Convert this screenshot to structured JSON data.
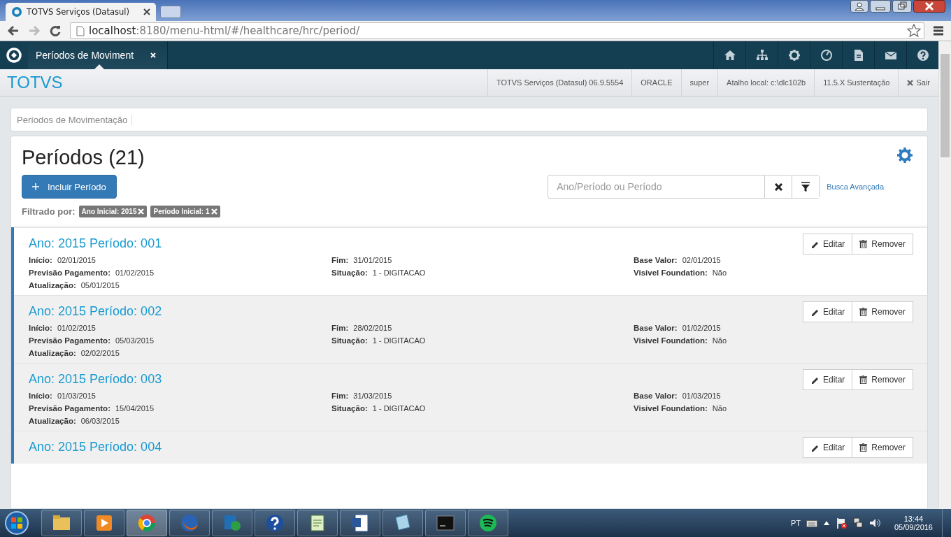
{
  "browser": {
    "tab_title": "TOTVS Serviços (Datasul)",
    "url_host": "localhost",
    "url_path": ":8180/menu-html/#/healthcare/hrc/period/"
  },
  "app_tabs": [
    {
      "label": "Períodos de Moviment",
      "selected": true
    }
  ],
  "header": {
    "brand": "TOTVS",
    "info": [
      "TOTVS Serviços (Datasul) 06.9.5554",
      "ORACLE",
      "super",
      "Atalho local: c:\\dlc102b",
      "11.5.X Sustentação"
    ],
    "logout": "Sair"
  },
  "breadcrumb": [
    "Períodos de Movimentação"
  ],
  "page": {
    "title": "Períodos (21)",
    "add_button": "Incluir Período",
    "search": {
      "placeholder": "Ano/Período ou Período"
    },
    "advanced_link": "Busca Avançada",
    "filter_label": "Filtrado por:",
    "filters": [
      "Ano Inicial: 2015",
      "Período Inicial: 1"
    ]
  },
  "periods": [
    {
      "title": "Ano: 2015 Período: 001",
      "edit": "Editar",
      "remove": "Remover",
      "fields": [
        {
          "label": "Início:",
          "value": "02/01/2015"
        },
        {
          "label": "Fim:",
          "value": "31/01/2015"
        },
        {
          "label": "Base Valor:",
          "value": "02/01/2015"
        },
        {
          "label": "Previsão Pagamento:",
          "value": "01/02/2015"
        },
        {
          "label": "Situação:",
          "value": "1 - DIGITACAO"
        },
        {
          "label": "Visivel Foundation:",
          "value": "Não"
        },
        {
          "label": "Atualização:",
          "value": "05/01/2015"
        }
      ]
    },
    {
      "title": "Ano: 2015 Período: 002",
      "edit": "Editar",
      "remove": "Remover",
      "fields": [
        {
          "label": "Início:",
          "value": "01/02/2015"
        },
        {
          "label": "Fim:",
          "value": "28/02/2015"
        },
        {
          "label": "Base Valor:",
          "value": "01/02/2015"
        },
        {
          "label": "Previsão Pagamento:",
          "value": "05/03/2015"
        },
        {
          "label": "Situação:",
          "value": "1 - DIGITACAO"
        },
        {
          "label": "Visivel Foundation:",
          "value": "Não"
        },
        {
          "label": "Atualização:",
          "value": "02/02/2015"
        }
      ]
    },
    {
      "title": "Ano: 2015 Período: 003",
      "edit": "Editar",
      "remove": "Remover",
      "fields": [
        {
          "label": "Início:",
          "value": "01/03/2015"
        },
        {
          "label": "Fim:",
          "value": "31/03/2015"
        },
        {
          "label": "Base Valor:",
          "value": "01/03/2015"
        },
        {
          "label": "Previsão Pagamento:",
          "value": "15/04/2015"
        },
        {
          "label": "Situação:",
          "value": "1 - DIGITACAO"
        },
        {
          "label": "Visivel Foundation:",
          "value": "Não"
        },
        {
          "label": "Atualização:",
          "value": "06/03/2015"
        }
      ]
    },
    {
      "title": "Ano: 2015 Período: 004",
      "edit": "Editar",
      "remove": "Remover"
    }
  ],
  "taskbar": {
    "language": "PT",
    "time": "13:44",
    "date": "05/09/2016"
  }
}
